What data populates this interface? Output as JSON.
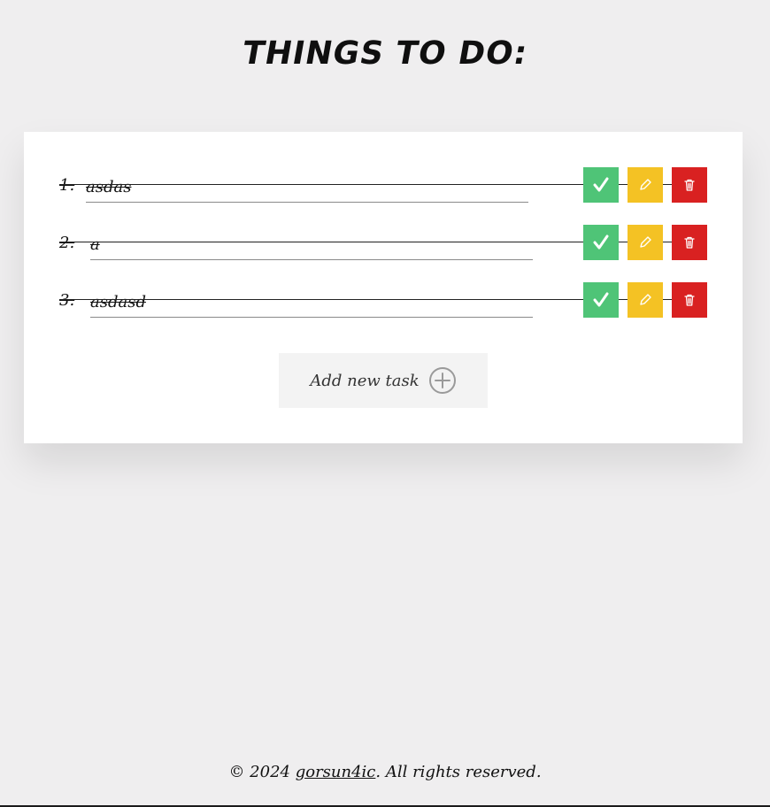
{
  "header": {
    "title": "THINGS TO DO:"
  },
  "tasks": [
    {
      "number": "1.",
      "text": "asdas"
    },
    {
      "number": "2.",
      "text": "a"
    },
    {
      "number": "3.",
      "text": "asdasd"
    }
  ],
  "add_task": {
    "label": "Add new task",
    "icon": "plus-circle-icon"
  },
  "footer": {
    "prefix": "© 2024",
    "author": "gorsun4ic",
    "suffix": ". All rights reserved."
  },
  "colors": {
    "background": "#efeeef",
    "done": "#4fc477",
    "edit": "#f4c224",
    "delete": "#d92121"
  }
}
